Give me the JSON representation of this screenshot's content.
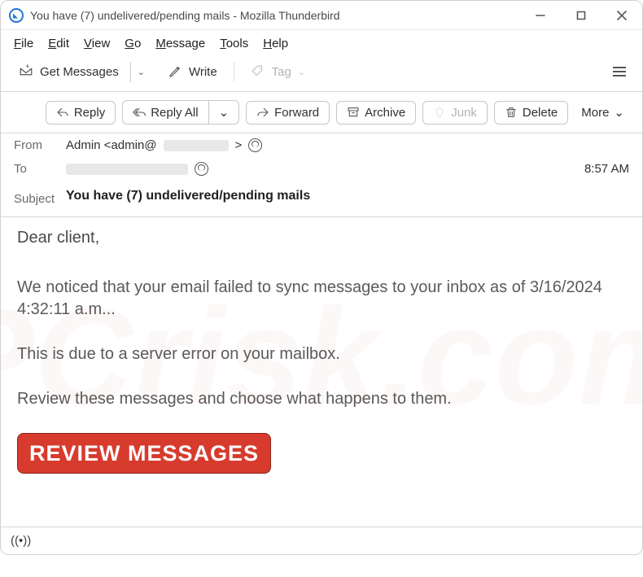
{
  "window": {
    "title": "You have (7) undelivered/pending mails - Mozilla Thunderbird",
    "minimize_icon": "minimize-icon",
    "maximize_icon": "maximize-icon",
    "close_icon": "close-icon"
  },
  "menubar": [
    {
      "label": "File",
      "accel": "F"
    },
    {
      "label": "Edit",
      "accel": "E"
    },
    {
      "label": "View",
      "accel": "V"
    },
    {
      "label": "Go",
      "accel": "G"
    },
    {
      "label": "Message",
      "accel": "M"
    },
    {
      "label": "Tools",
      "accel": "T"
    },
    {
      "label": "Help",
      "accel": "H"
    }
  ],
  "toolbar": {
    "get_messages": "Get Messages",
    "write": "Write",
    "tag": "Tag"
  },
  "actions": {
    "reply": "Reply",
    "reply_all": "Reply All",
    "forward": "Forward",
    "archive": "Archive",
    "junk": "Junk",
    "delete": "Delete",
    "more": "More"
  },
  "header": {
    "from_label": "From",
    "from_value": "Admin <admin@",
    "from_after": " >",
    "to_label": "To",
    "subject_label": "Subject",
    "subject_value": "You have (7) undelivered/pending mails",
    "time": "8:57 AM"
  },
  "body": {
    "salutation": "Dear client,",
    "p1": "We noticed that your email failed to sync messages to your inbox as of 3/16/2024 4:32:11 a.m...",
    "p2": "This is due to a server error on your mailbox.",
    "p3": "Review these messages and choose what happens to them.",
    "cta": "REVIEW MESSAGES"
  },
  "statusbar": {
    "connection": "((•))"
  }
}
